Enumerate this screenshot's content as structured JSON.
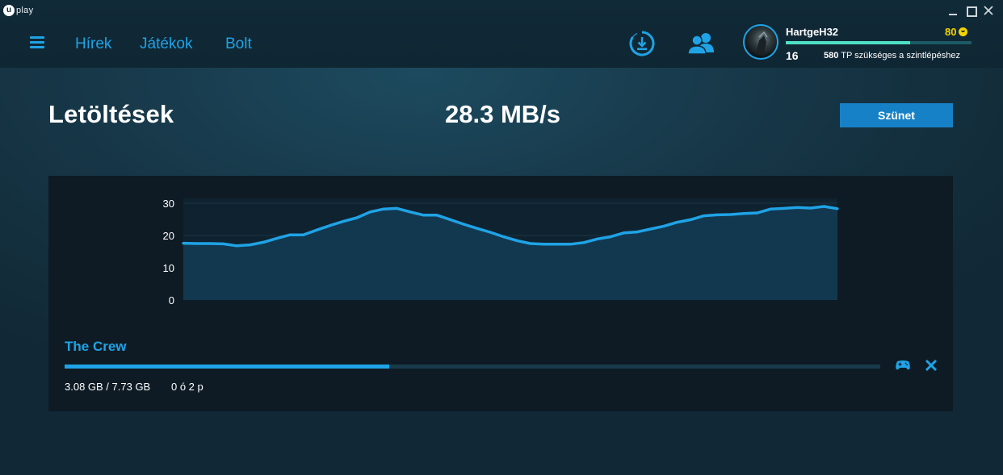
{
  "app": {
    "logo_text": "play",
    "logo_letter": "u"
  },
  "nav": {
    "items": [
      {
        "label": "Hírek"
      },
      {
        "label": "Játékok"
      },
      {
        "label": "Bolt"
      }
    ]
  },
  "user": {
    "name": "HartgeH32",
    "coins": "80",
    "level": "16",
    "xp_needed": "580",
    "xp_suffix": "TP szükséges a szintlépéshez",
    "xp_progress_fraction": 0.67
  },
  "main": {
    "title": "Letöltések",
    "speed": "28.3 MB/s",
    "pause_label": "Szünet"
  },
  "download": {
    "game_title": "The Crew",
    "size_text": "3.08 GB / 7.73 GB",
    "time_text": "0 ó 2 p",
    "progress_fraction": 0.3985
  },
  "colors": {
    "accent": "#1fa3e6",
    "coin": "#f5d300",
    "xp": "#4ee0c4",
    "button": "#1781c7"
  },
  "chart_data": {
    "type": "area",
    "y_ticks": [
      "30",
      "20",
      "10",
      "0"
    ],
    "ylim": [
      0,
      30
    ],
    "grid": true,
    "values": [
      17.6,
      17.5,
      17.5,
      17.4,
      16.8,
      17.1,
      17.9,
      19.1,
      20.2,
      20.2,
      21.7,
      23.1,
      24.4,
      25.5,
      27.3,
      28.2,
      28.4,
      27.3,
      26.3,
      26.3,
      24.9,
      23.5,
      22.2,
      21.0,
      19.6,
      18.4,
      17.5,
      17.3,
      17.3,
      17.3,
      17.8,
      18.9,
      19.6,
      20.8,
      21.1,
      22.0,
      22.9,
      24.1,
      24.9,
      26.1,
      26.4,
      26.5,
      26.8,
      27.0,
      28.2,
      28.4,
      28.7,
      28.5,
      29.0,
      28.3
    ]
  }
}
